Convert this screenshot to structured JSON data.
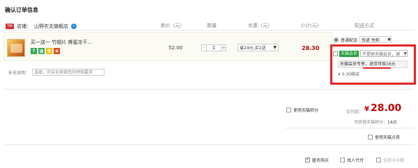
{
  "page": {
    "title": "确认订单信息"
  },
  "columns": {
    "price": "单价（元）",
    "qty": "数量",
    "discount": "优惠（元）",
    "subtotal": "小计(元)",
    "shipping": "配送方式"
  },
  "shop": {
    "label": "店铺：",
    "name": "山野农夫旗舰店",
    "icon": "tmall-icon",
    "chat_icon": "wangwang-icon"
  },
  "item": {
    "title": "买一送一 竹帽片 蜂蜜冻干...",
    "badges": [
      "7",
      "退",
      "货"
    ],
    "price": "52.00",
    "quantity": "1",
    "qty_minus": "-",
    "qty_plus": "+",
    "discount_value": "省24元:买1送",
    "subtotal": "28.30"
  },
  "shipping": {
    "option": "普通配送",
    "select_value": "快递 免邮"
  },
  "tmall_member": {
    "tag": "天猫会员",
    "select_placeholder": "不提供天猫会员，谢",
    "note": "天猫会员专享，退货可赔16元",
    "buy_text": "¥ 0.30购买"
  },
  "remark": {
    "label": "补充说明：",
    "placeholder": "选填，可告诉卖家您的特殊要求"
  },
  "summary": {
    "points_label": "使用天猫积分",
    "pay_label": "实付款：",
    "currency": "¥",
    "total": "28.00",
    "earn_label": "可获得天猫积分：",
    "earn_value": "14点",
    "coupon_label": "使用天猫点券"
  },
  "bottom_options": {
    "anonymous": "匿名购买",
    "proxy_pay": "找人代付",
    "credit_card": "信用卡分期"
  },
  "colors": {
    "price_red": "#c40000",
    "highlight_red": "#e02424",
    "tmall_green": "#1d9e3a"
  }
}
